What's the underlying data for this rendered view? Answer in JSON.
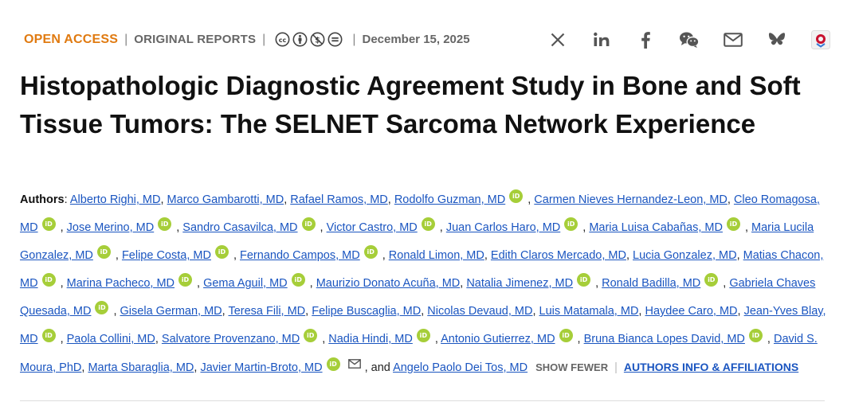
{
  "header": {
    "open_access": "OPEN ACCESS",
    "article_type": "ORIGINAL REPORTS",
    "date": "December 15, 2025",
    "license_icons": [
      "creative-commons-icon",
      "attribution-icon",
      "noncommercial-icon",
      "noderivatives-icon"
    ],
    "share_icons": [
      "x-icon",
      "linkedin-icon",
      "facebook-icon",
      "wechat-icon",
      "email-icon",
      "bluesky-icon",
      "mendeley-icon"
    ],
    "accent_color": "#e07a10"
  },
  "title": "Histopathologic Diagnostic Agreement Study in Bone and Soft Tissue Tumors: The SELNET Sarcoma Network Experience",
  "authors_label": "Authors",
  "authors": [
    {
      "name": "Alberto Righi, MD",
      "orcid": false
    },
    {
      "name": "Marco Gambarotti, MD",
      "orcid": false
    },
    {
      "name": "Rafael Ramos, MD",
      "orcid": false
    },
    {
      "name": "Rodolfo Guzman, MD",
      "orcid": true
    },
    {
      "name": "Carmen Nieves Hernandez-Leon, MD",
      "orcid": false
    },
    {
      "name": "Cleo Romagosa, MD",
      "orcid": true
    },
    {
      "name": "Jose Merino, MD",
      "orcid": true
    },
    {
      "name": "Sandro Casavilca, MD",
      "orcid": true
    },
    {
      "name": "Victor Castro, MD",
      "orcid": true
    },
    {
      "name": "Juan Carlos Haro, MD",
      "orcid": true
    },
    {
      "name": "Maria Luisa Cabañas, MD",
      "orcid": true
    },
    {
      "name": "Maria Lucila Gonzalez, MD",
      "orcid": true
    },
    {
      "name": "Felipe Costa, MD",
      "orcid": true
    },
    {
      "name": "Fernando Campos, MD",
      "orcid": true
    },
    {
      "name": "Ronald Limon, MD",
      "orcid": false
    },
    {
      "name": "Edith Claros Mercado, MD",
      "orcid": false
    },
    {
      "name": "Lucia Gonzalez, MD",
      "orcid": false
    },
    {
      "name": "Matias Chacon, MD",
      "orcid": true
    },
    {
      "name": "Marina Pacheco, MD",
      "orcid": true
    },
    {
      "name": "Gema Aguil, MD",
      "orcid": true
    },
    {
      "name": "Maurizio Donato Acuña, MD",
      "orcid": false
    },
    {
      "name": "Natalia Jimenez, MD",
      "orcid": true
    },
    {
      "name": "Ronald Badilla, MD",
      "orcid": true
    },
    {
      "name": "Gabriela Chaves Quesada, MD",
      "orcid": true
    },
    {
      "name": "Gisela German, MD",
      "orcid": false
    },
    {
      "name": "Teresa Fili, MD",
      "orcid": false
    },
    {
      "name": "Felipe Buscaglia, MD",
      "orcid": false
    },
    {
      "name": "Nicolas Devaud, MD",
      "orcid": false
    },
    {
      "name": "Luis Matamala, MD",
      "orcid": false
    },
    {
      "name": "Haydee Caro, MD",
      "orcid": false
    },
    {
      "name": "Jean-Yves Blay, MD",
      "orcid": true
    },
    {
      "name": "Paola Collini, MD",
      "orcid": false
    },
    {
      "name": "Salvatore Provenzano, MD",
      "orcid": true
    },
    {
      "name": "Nadia Hindi, MD",
      "orcid": true
    },
    {
      "name": "Antonio Gutierrez, MD",
      "orcid": true
    },
    {
      "name": "Bruna Bianca Lopes David, MD",
      "orcid": true
    },
    {
      "name": "David S. Moura, PhD",
      "orcid": false
    },
    {
      "name": "Marta Sbaraglia, MD",
      "orcid": false
    },
    {
      "name": "Javier Martin-Broto, MD",
      "orcid": true,
      "email": true
    },
    {
      "name": "Angelo Paolo Dei Tos, MD",
      "orcid": false
    }
  ],
  "orcid_label": "iD",
  "and_word": "and",
  "show_fewer": "SHOW FEWER",
  "info_link": "AUTHORS INFO & AFFILIATIONS",
  "orcid_color": "#a6ce39",
  "link_color": "#1a55c0"
}
